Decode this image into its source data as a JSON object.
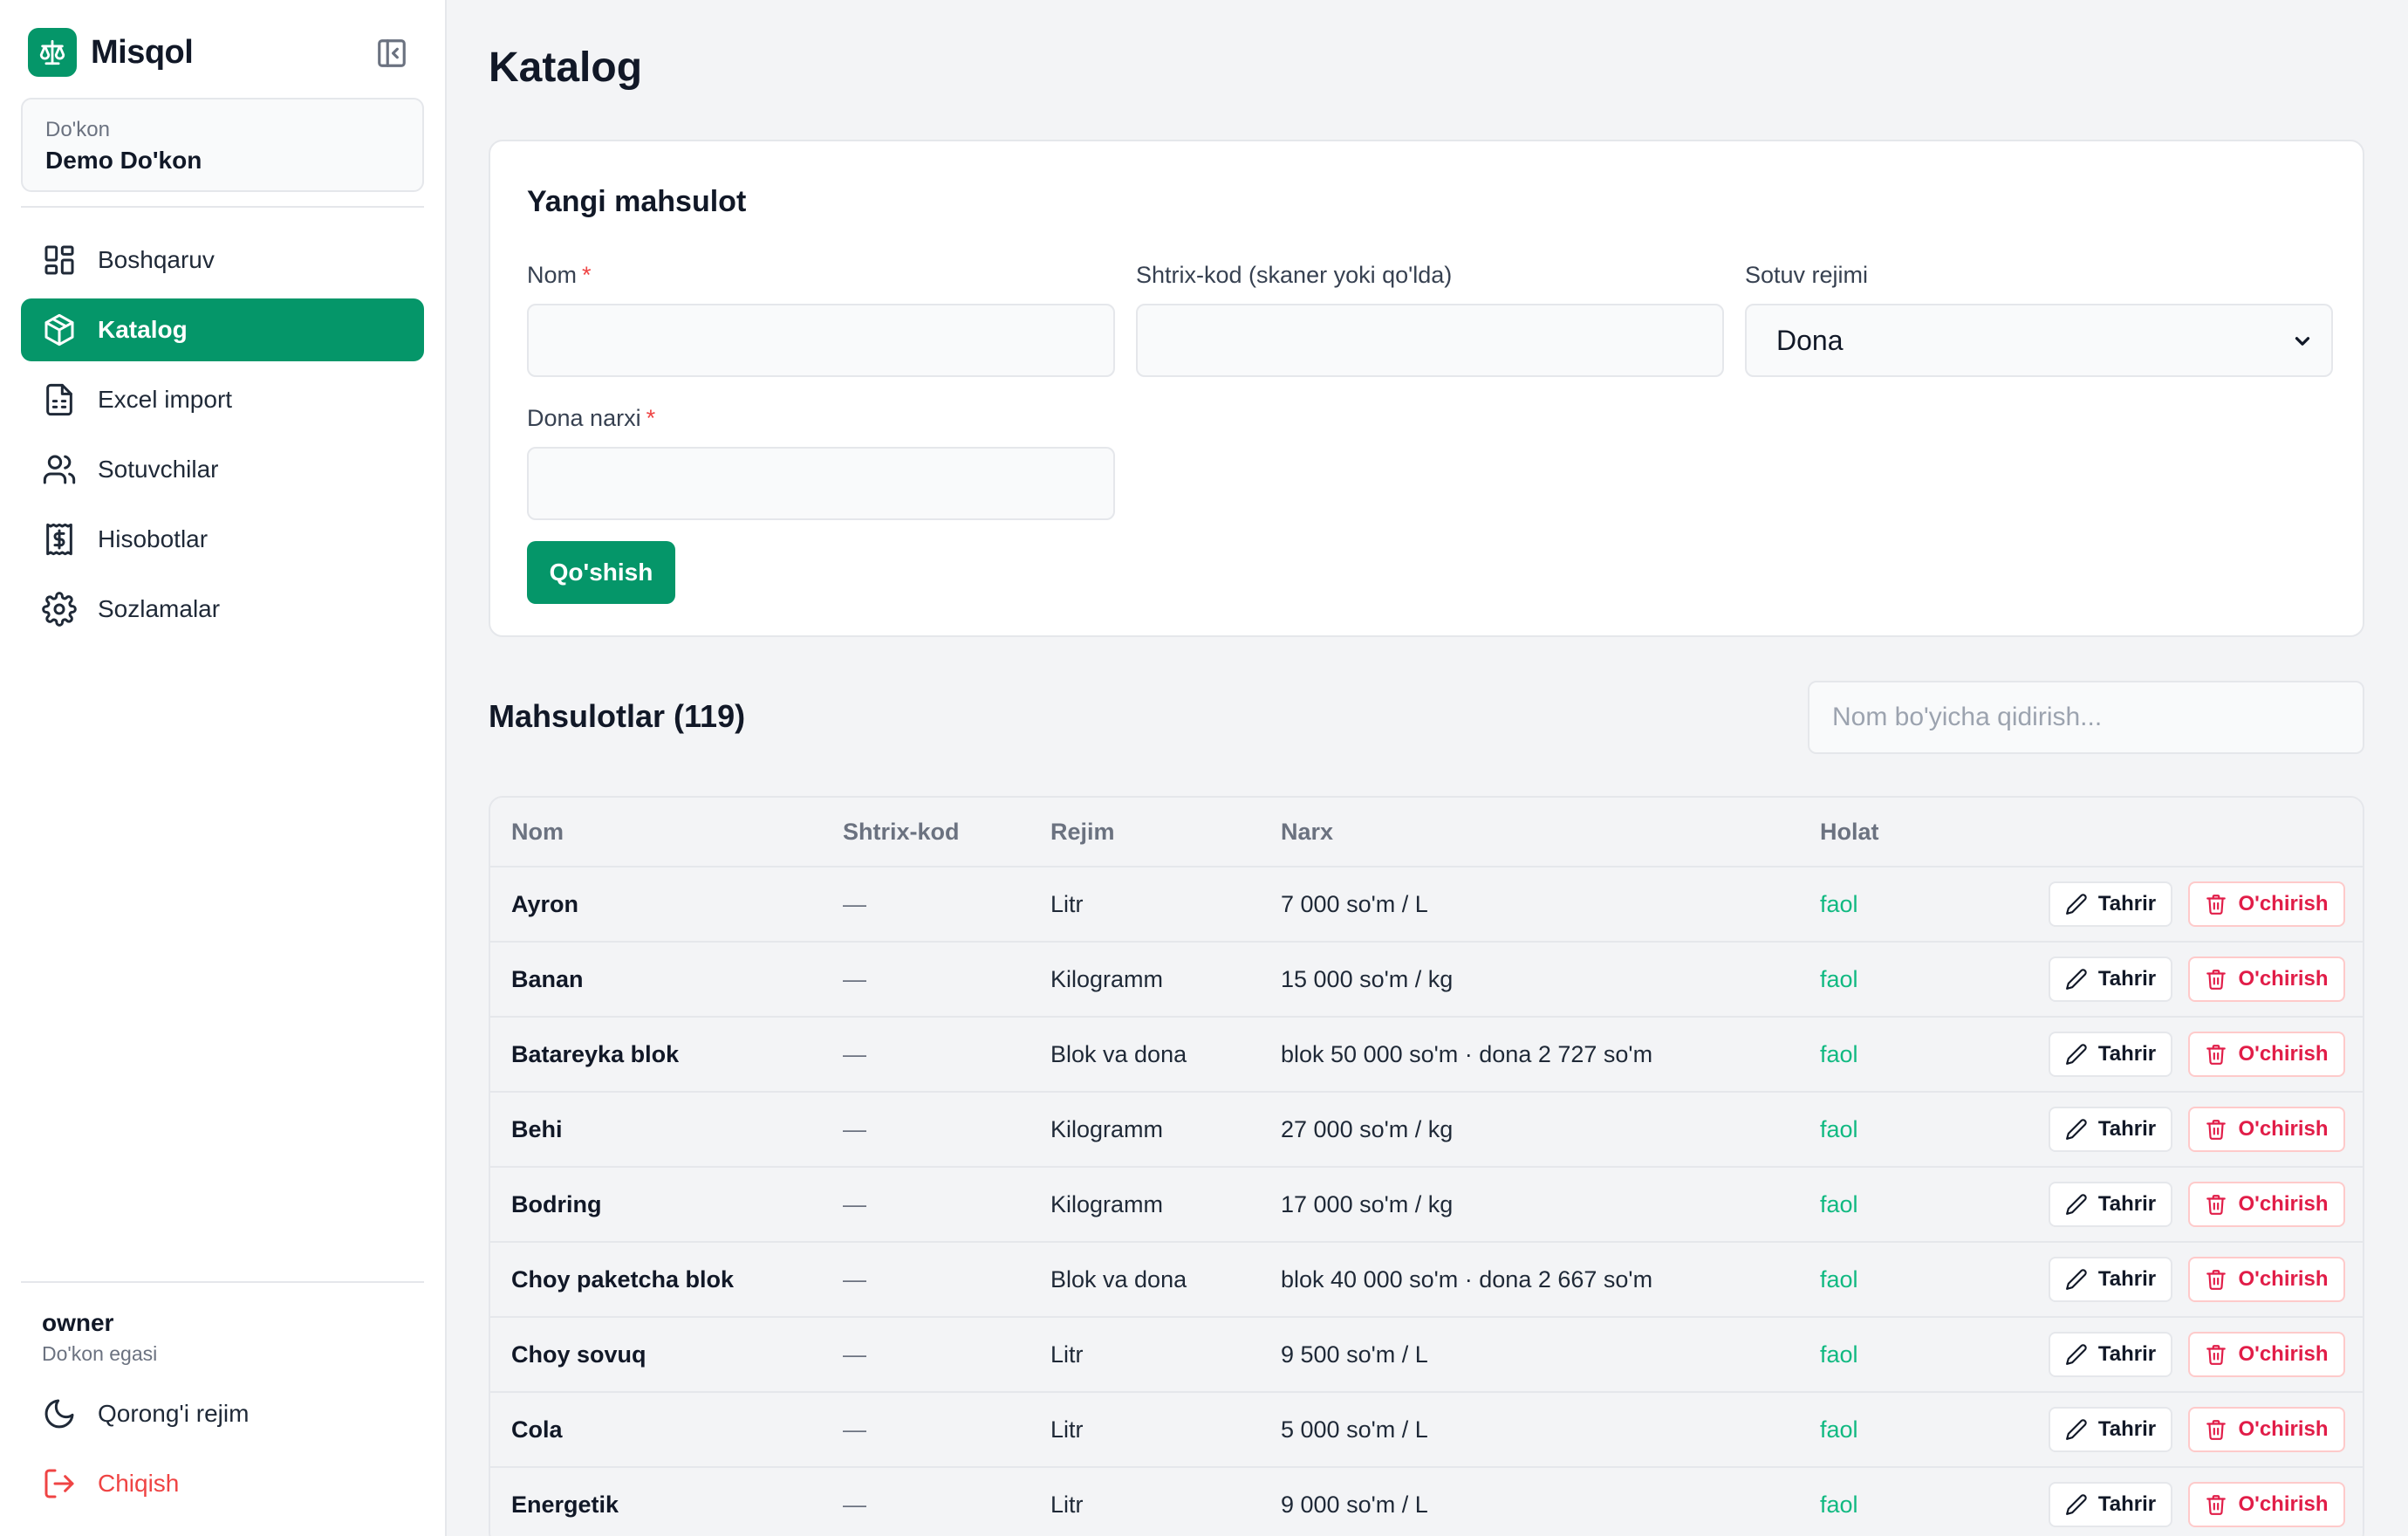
{
  "app": {
    "name": "Misqol"
  },
  "store": {
    "label": "Do'kon",
    "name": "Demo Do'kon"
  },
  "nav": [
    {
      "label": "Boshqaruv",
      "icon": "dashboard-icon"
    },
    {
      "label": "Katalog",
      "icon": "package-icon",
      "active": true
    },
    {
      "label": "Excel import",
      "icon": "file-spreadsheet-icon"
    },
    {
      "label": "Sotuvchilar",
      "icon": "users-icon"
    },
    {
      "label": "Hisobotlar",
      "icon": "receipt-icon"
    },
    {
      "label": "Sozlamalar",
      "icon": "gear-icon"
    }
  ],
  "user": {
    "name": "owner",
    "role": "Do'kon egasi"
  },
  "actions": {
    "dark_mode": "Qorong'i rejim",
    "logout": "Chiqish"
  },
  "page": {
    "title": "Katalog"
  },
  "form": {
    "title": "Yangi mahsulot",
    "name_label": "Nom",
    "barcode_label": "Shtrix-kod (skaner yoki qo'lda)",
    "mode_label": "Sotuv rejimi",
    "mode_value": "Dona",
    "price_label": "Dona narxi",
    "required_mark": "*",
    "submit": "Qo'shish"
  },
  "list": {
    "title": "Mahsulotlar (119)",
    "search_placeholder": "Nom bo'yicha qidirish...",
    "columns": {
      "name": "Nom",
      "barcode": "Shtrix-kod",
      "mode": "Rejim",
      "price": "Narx",
      "status": "Holat"
    },
    "edit_label": "Tahrir",
    "delete_label": "O'chirish",
    "rows": [
      {
        "name": "Ayron",
        "barcode": "—",
        "mode": "Litr",
        "price": "7 000 so'm / L",
        "status": "faol"
      },
      {
        "name": "Banan",
        "barcode": "—",
        "mode": "Kilogramm",
        "price": "15 000 so'm / kg",
        "status": "faol"
      },
      {
        "name": "Batareyka blok",
        "barcode": "—",
        "mode": "Blok va dona",
        "price": "blok 50 000 so'm · dona 2 727 so'm",
        "status": "faol"
      },
      {
        "name": "Behi",
        "barcode": "—",
        "mode": "Kilogramm",
        "price": "27 000 so'm / kg",
        "status": "faol"
      },
      {
        "name": "Bodring",
        "barcode": "—",
        "mode": "Kilogramm",
        "price": "17 000 so'm / kg",
        "status": "faol"
      },
      {
        "name": "Choy paketcha blok",
        "barcode": "—",
        "mode": "Blok va dona",
        "price": "blok 40 000 so'm · dona 2 667 so'm",
        "status": "faol"
      },
      {
        "name": "Choy sovuq",
        "barcode": "—",
        "mode": "Litr",
        "price": "9 500 so'm / L",
        "status": "faol"
      },
      {
        "name": "Cola",
        "barcode": "—",
        "mode": "Litr",
        "price": "5 000 so'm / L",
        "status": "faol"
      },
      {
        "name": "Energetik",
        "barcode": "—",
        "mode": "Litr",
        "price": "9 000 so'm / L",
        "status": "faol"
      }
    ]
  },
  "colors": {
    "accent": "#059669",
    "status_active": "#10b981",
    "danger": "#e11d48"
  }
}
